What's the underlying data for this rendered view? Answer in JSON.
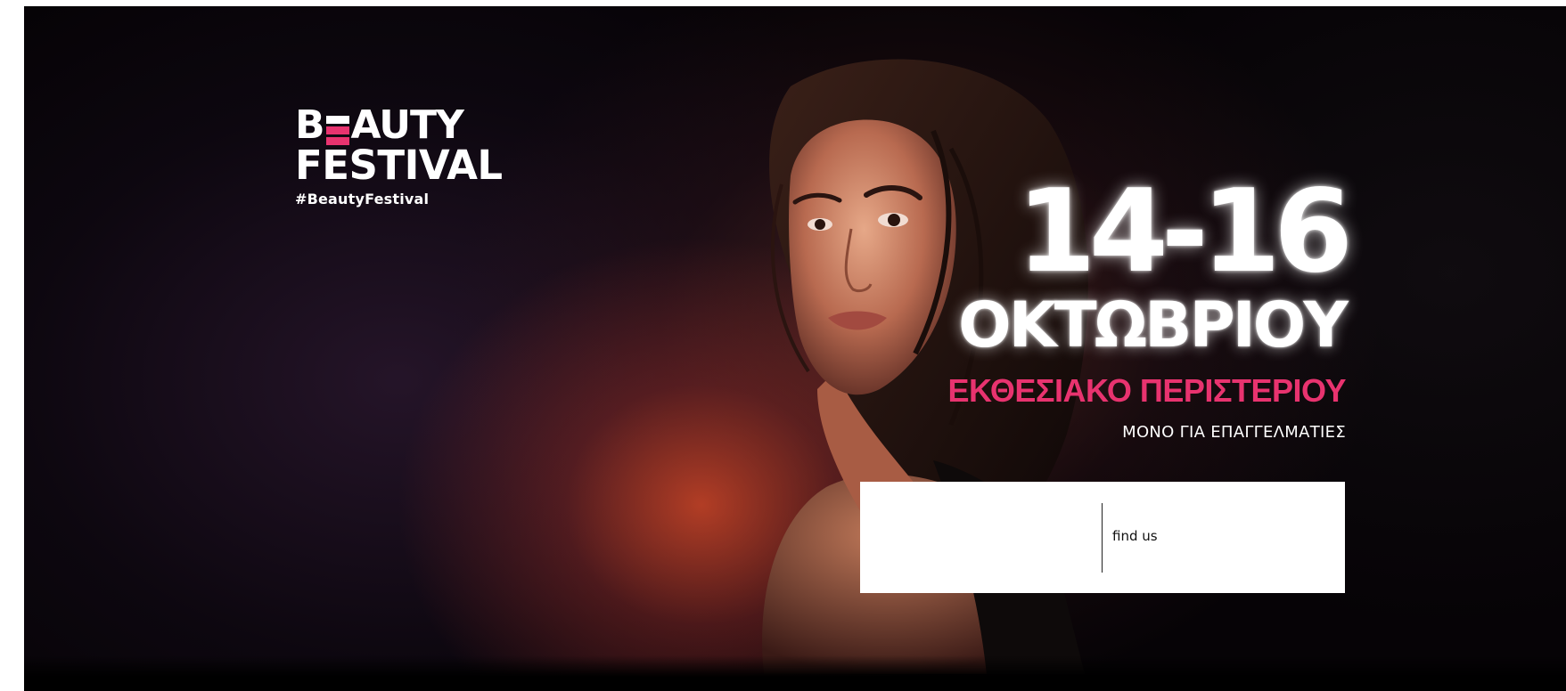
{
  "logo": {
    "line1_prefix": "B",
    "line1_suffix": "AUTY",
    "line2": "FESTIVAL",
    "hashtag": "#BeautyFestival",
    "accent_colors": [
      "#ffffff",
      "#e8336f",
      "#e8336f"
    ]
  },
  "event": {
    "dates": "14-16",
    "month": "ΟΚΤΩΒΡΙΟΥ",
    "venue": "ΕΚΘΕΣΙΑΚΟ ΠΕΡΙΣΤΕΡΙΟΥ",
    "audience": "ΜΟΝΟ ΓΙΑ ΕΠΑΓΓΕΛΜΑΤΙΕΣ"
  },
  "info_box": {
    "link_label": "find us"
  },
  "colors": {
    "accent": "#e8336f",
    "background": "#060306",
    "text": "#ffffff"
  }
}
